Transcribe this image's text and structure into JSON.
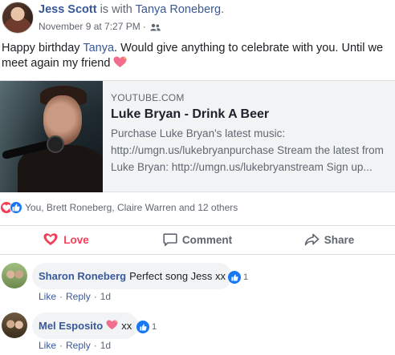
{
  "post": {
    "author": "Jess Scott",
    "with_text": "is with",
    "tagged": "Tanya Roneberg",
    "tagged_end": ".",
    "timestamp": "November 9 at 7:27 PM",
    "separator": "·",
    "audience_icon": "friends-icon",
    "text_before": "Happy birthday",
    "text_mention": "Tanya",
    "text_after": ". Would give anything to celebrate with you. Until we meet again my friend",
    "emoji": "heart-emoji"
  },
  "link_card": {
    "domain": "YOUTUBE.COM",
    "title": "Luke Bryan - Drink A Beer",
    "desc_line1": "Purchase Luke Bryan's latest music:",
    "desc_line2": "http://umgn.us/lukebryanpurchase Stream the latest from",
    "desc_line3": "Luke Bryan: http://umgn.us/lukebryanstream Sign up..."
  },
  "reactions": {
    "types": [
      "love",
      "like"
    ],
    "summary": "You, Brett Roneberg, Claire Warren and 12 others"
  },
  "actions": {
    "love": "Love",
    "comment": "Comment",
    "share": "Share"
  },
  "comments": [
    {
      "name": "Sharon Roneberg",
      "text": "Perfect song Jess xx",
      "like_count": "1",
      "like_label": "Like",
      "reply_label": "Reply",
      "dot": "·",
      "age": "1d"
    },
    {
      "name": "Mel Esposito",
      "text": "xx",
      "like_count": "1",
      "like_label": "Like",
      "reply_label": "Reply",
      "dot": "·",
      "age": "1d"
    }
  ],
  "colors": {
    "link_blue": "#385898",
    "love_red": "#f33e58",
    "like_blue": "#1877f2",
    "meta_gray": "#606770"
  }
}
